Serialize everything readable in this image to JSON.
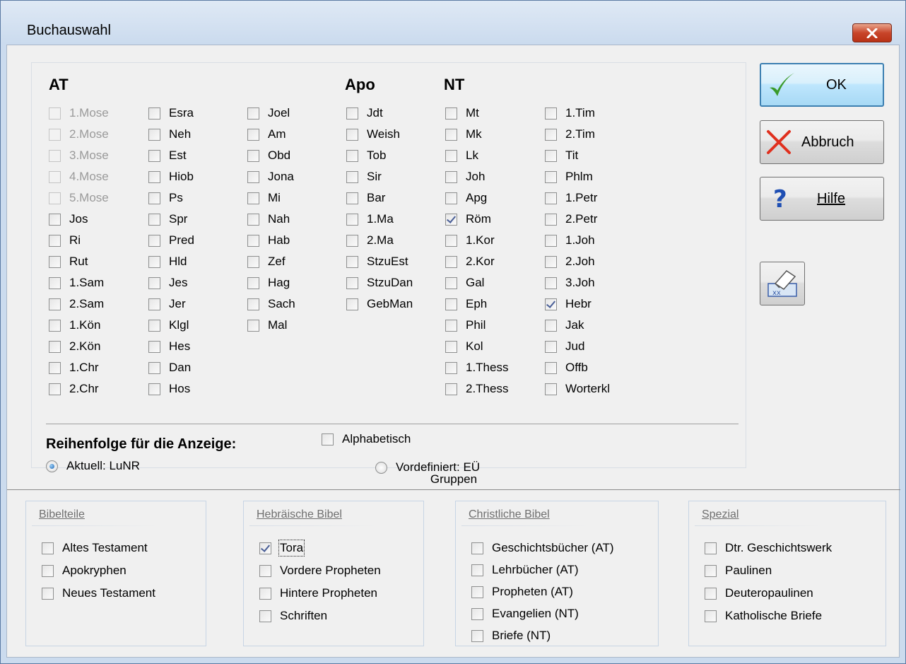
{
  "window": {
    "title": "Buchauswahl",
    "close_label": "Schließen"
  },
  "books": {
    "at_heading": "AT",
    "apo_heading": "Apo",
    "nt_heading": "NT",
    "at_col1": [
      {
        "label": "1.Mose",
        "checked": false,
        "disabled": true
      },
      {
        "label": "2.Mose",
        "checked": false,
        "disabled": true
      },
      {
        "label": "3.Mose",
        "checked": false,
        "disabled": true
      },
      {
        "label": "4.Mose",
        "checked": false,
        "disabled": true
      },
      {
        "label": "5.Mose",
        "checked": false,
        "disabled": true
      },
      {
        "label": "Jos",
        "checked": false,
        "disabled": false
      },
      {
        "label": "Ri",
        "checked": false,
        "disabled": false
      },
      {
        "label": "Rut",
        "checked": false,
        "disabled": false
      },
      {
        "label": "1.Sam",
        "checked": false,
        "disabled": false
      },
      {
        "label": "2.Sam",
        "checked": false,
        "disabled": false
      },
      {
        "label": "1.Kön",
        "checked": false,
        "disabled": false
      },
      {
        "label": "2.Kön",
        "checked": false,
        "disabled": false
      },
      {
        "label": "1.Chr",
        "checked": false,
        "disabled": false
      },
      {
        "label": "2.Chr",
        "checked": false,
        "disabled": false
      }
    ],
    "at_col2": [
      {
        "label": "Esra",
        "checked": false
      },
      {
        "label": "Neh",
        "checked": false
      },
      {
        "label": "Est",
        "checked": false
      },
      {
        "label": "Hiob",
        "checked": false
      },
      {
        "label": "Ps",
        "checked": false
      },
      {
        "label": "Spr",
        "checked": false
      },
      {
        "label": "Pred",
        "checked": false
      },
      {
        "label": "Hld",
        "checked": false
      },
      {
        "label": "Jes",
        "checked": false
      },
      {
        "label": "Jer",
        "checked": false
      },
      {
        "label": "Klgl",
        "checked": false
      },
      {
        "label": "Hes",
        "checked": false
      },
      {
        "label": "Dan",
        "checked": false
      },
      {
        "label": "Hos",
        "checked": false
      }
    ],
    "at_col3": [
      {
        "label": "Joel",
        "checked": false
      },
      {
        "label": "Am",
        "checked": false
      },
      {
        "label": "Obd",
        "checked": false
      },
      {
        "label": "Jona",
        "checked": false
      },
      {
        "label": "Mi",
        "checked": false
      },
      {
        "label": "Nah",
        "checked": false
      },
      {
        "label": "Hab",
        "checked": false
      },
      {
        "label": "Zef",
        "checked": false
      },
      {
        "label": "Hag",
        "checked": false
      },
      {
        "label": "Sach",
        "checked": false
      },
      {
        "label": "Mal",
        "checked": false
      }
    ],
    "apo_col": [
      {
        "label": "Jdt",
        "checked": false
      },
      {
        "label": "Weish",
        "checked": false
      },
      {
        "label": "Tob",
        "checked": false
      },
      {
        "label": "Sir",
        "checked": false
      },
      {
        "label": "Bar",
        "checked": false
      },
      {
        "label": "1.Ma",
        "checked": false
      },
      {
        "label": "2.Ma",
        "checked": false
      },
      {
        "label": "StzuEst",
        "checked": false
      },
      {
        "label": "StzuDan",
        "checked": false
      },
      {
        "label": "GebMan",
        "checked": false
      }
    ],
    "nt_col1": [
      {
        "label": "Mt",
        "checked": false
      },
      {
        "label": "Mk",
        "checked": false
      },
      {
        "label": "Lk",
        "checked": false
      },
      {
        "label": "Joh",
        "checked": false
      },
      {
        "label": "Apg",
        "checked": false
      },
      {
        "label": "Röm",
        "checked": true
      },
      {
        "label": "1.Kor",
        "checked": false
      },
      {
        "label": "2.Kor",
        "checked": false
      },
      {
        "label": "Gal",
        "checked": false
      },
      {
        "label": "Eph",
        "checked": false
      },
      {
        "label": "Phil",
        "checked": false
      },
      {
        "label": "Kol",
        "checked": false
      },
      {
        "label": "1.Thess",
        "checked": false
      },
      {
        "label": "2.Thess",
        "checked": false
      }
    ],
    "nt_col2": [
      {
        "label": "1.Tim",
        "checked": false
      },
      {
        "label": "2.Tim",
        "checked": false
      },
      {
        "label": "Tit",
        "checked": false
      },
      {
        "label": "Phlm",
        "checked": false
      },
      {
        "label": "1.Petr",
        "checked": false
      },
      {
        "label": "2.Petr",
        "checked": false
      },
      {
        "label": "1.Joh",
        "checked": false
      },
      {
        "label": "2.Joh",
        "checked": false
      },
      {
        "label": "3.Joh",
        "checked": false
      },
      {
        "label": "Hebr",
        "checked": true
      },
      {
        "label": "Jak",
        "checked": false
      },
      {
        "label": "Jud",
        "checked": false
      },
      {
        "label": "Offb",
        "checked": false
      },
      {
        "label": "Worterkl",
        "checked": false
      }
    ]
  },
  "order": {
    "label": "Reihenfolge für die Anzeige:",
    "alpha_label": "Alphabetisch",
    "alpha_checked": false,
    "current_label": "Aktuell: LuNR",
    "current_selected": true,
    "predefined_label": "Vordefiniert: EÜ",
    "predefined_selected": false
  },
  "buttons": {
    "ok": "OK",
    "cancel": "Abbruch",
    "help": "Hilfe"
  },
  "groups": {
    "title": "Gruppen",
    "bibelteile": {
      "title": "Bibelteile",
      "items": [
        {
          "label": "Altes Testament",
          "checked": false
        },
        {
          "label": "Apokryphen",
          "checked": false
        },
        {
          "label": "Neues Testament",
          "checked": false
        }
      ]
    },
    "hebraeisch": {
      "title": "Hebräische Bibel",
      "items": [
        {
          "label": "Tora",
          "checked": true
        },
        {
          "label": "Vordere Propheten",
          "checked": false
        },
        {
          "label": "Hintere Propheten",
          "checked": false
        },
        {
          "label": "Schriften",
          "checked": false
        }
      ]
    },
    "christlich": {
      "title": "Christliche Bibel",
      "items": [
        {
          "label": "Geschichtsbücher (AT)",
          "checked": false
        },
        {
          "label": "Lehrbücher (AT)",
          "checked": false
        },
        {
          "label": "Propheten (AT)",
          "checked": false
        },
        {
          "label": "Evangelien (NT)",
          "checked": false
        },
        {
          "label": "Briefe (NT)",
          "checked": false
        }
      ]
    },
    "spezial": {
      "title": "Spezial",
      "items": [
        {
          "label": "Dtr. Geschichtswerk",
          "checked": false
        },
        {
          "label": "Paulinen",
          "checked": false
        },
        {
          "label": "Deuteropaulinen",
          "checked": false
        },
        {
          "label": "Katholische Briefe",
          "checked": false
        }
      ]
    }
  },
  "colors": {
    "accent": "#3c7fb1",
    "check": "#4a5f97",
    "cancel_red": "#e0301e",
    "ok_green": "#3a9a2a",
    "help_blue": "#1f4fb3"
  }
}
